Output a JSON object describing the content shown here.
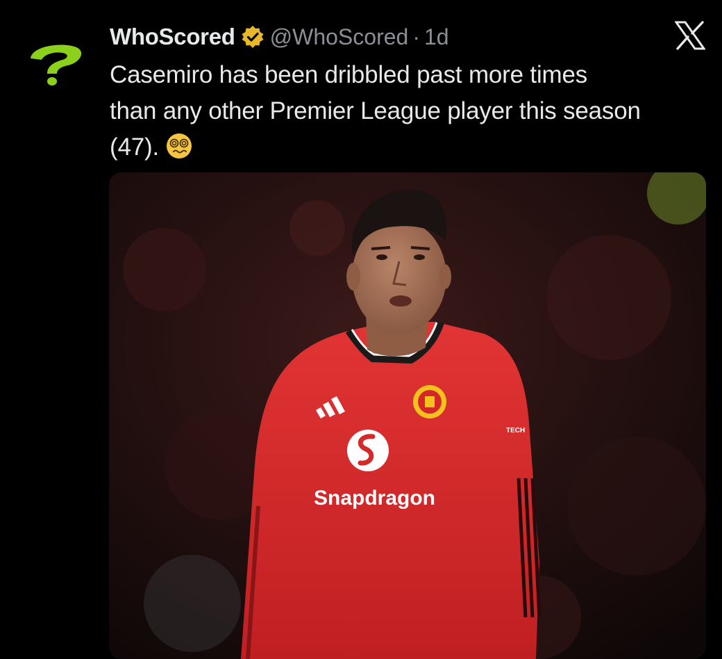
{
  "tweet": {
    "display_name": "WhoScored",
    "handle": "@WhoScored",
    "separator": "·",
    "time": "1d",
    "text_lines": [
      "Casemiro has been dribbled past more times",
      "than any other Premier League player this season",
      "(47)."
    ],
    "emoji": "dizzy-face-emoji"
  },
  "icons": {
    "avatar": "whoscored-question-mark-logo",
    "verified": "verified-gold-badge-icon",
    "platform": "x-logo-icon"
  },
  "media": {
    "jersey_sponsor": "Snapdragon",
    "sleeve_text": "TECH"
  },
  "colors": {
    "background": "#000000",
    "text": "#e7e9ea",
    "muted": "#8b9097",
    "verified_gold": "#e8b82a",
    "logo_green": "#8bd11c",
    "jersey_red": "#d42a2a"
  }
}
